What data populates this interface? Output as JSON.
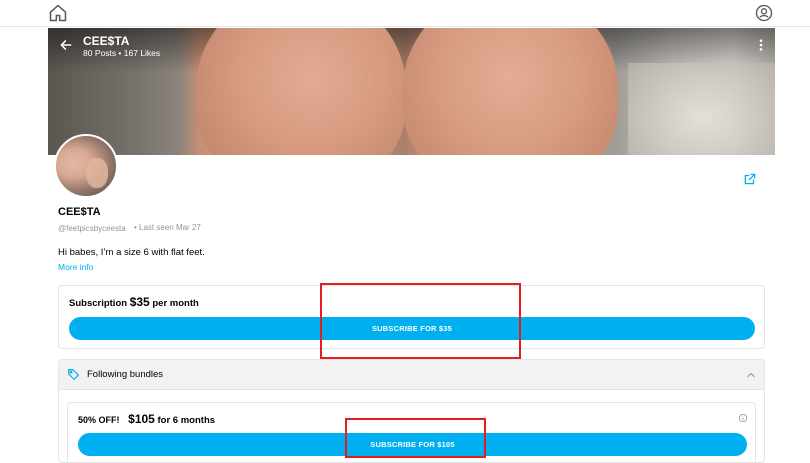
{
  "icons": {
    "home": "home-icon",
    "profile": "user-circle-icon",
    "back": "arrow-left-icon",
    "more": "kebab-icon",
    "share": "share-icon",
    "tag": "tag-icon",
    "collapse": "chevron-up-icon",
    "info": "info-icon"
  },
  "colors": {
    "accent": "#00aff0",
    "highlight": "#e02020",
    "muted": "#8a96a3"
  },
  "cover": {
    "name": "CEE$TA",
    "stats": "80 Posts • 167 Likes"
  },
  "profile": {
    "display_name": "CEE$TA",
    "handle": "@feetpicsbyceesta",
    "last_seen": "•  Last seen Mar 27",
    "bio": "Hi babes, I’m a size 6 with flat feet.",
    "more_info": "More info"
  },
  "subscription": {
    "label": "Subscription",
    "price": "$35",
    "period": "per month",
    "button": "SUBSCRIBE FOR $35"
  },
  "bundles": {
    "title": "Following bundles",
    "items": [
      {
        "discount": "50% OFF!",
        "price": "$105",
        "duration": "for 6 months",
        "button": "SUBSCRIBE FOR $105"
      }
    ]
  }
}
